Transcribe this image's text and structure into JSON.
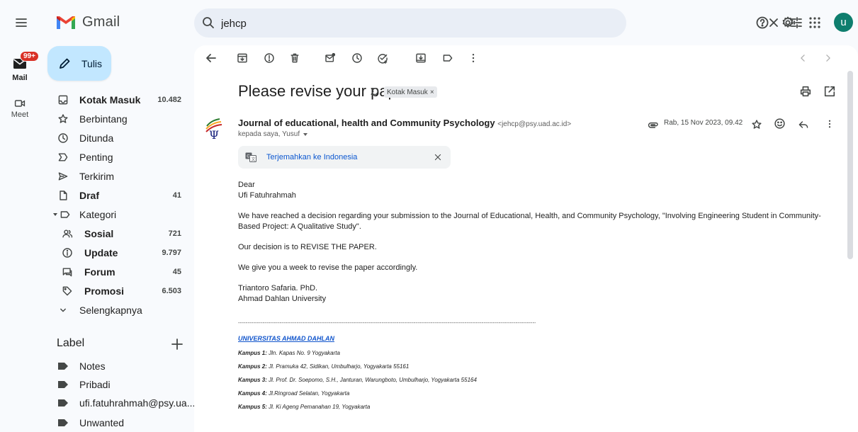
{
  "app": {
    "name": "Gmail"
  },
  "search": {
    "query": "jehcp"
  },
  "account": {
    "avatar_initial": "u"
  },
  "rail": {
    "mail_label": "Mail",
    "mail_badge": "99+",
    "meet_label": "Meet"
  },
  "compose": {
    "label": "Tulis"
  },
  "nav": [
    {
      "label": "Kotak Masuk",
      "count": "10.482",
      "icon": "inbox-icon",
      "bold": true
    },
    {
      "label": "Berbintang",
      "count": "",
      "icon": "star-icon"
    },
    {
      "label": "Ditunda",
      "count": "",
      "icon": "clock-icon"
    },
    {
      "label": "Penting",
      "count": "",
      "icon": "important-icon"
    },
    {
      "label": "Terkirim",
      "count": "",
      "icon": "send-icon"
    },
    {
      "label": "Draf",
      "count": "41",
      "icon": "draft-icon",
      "bold": true
    },
    {
      "label": "Kategori",
      "count": "",
      "icon": "label-icon"
    },
    {
      "label": "Sosial",
      "count": "721",
      "icon": "people-icon",
      "bold": true
    },
    {
      "label": "Update",
      "count": "9.797",
      "icon": "info-icon",
      "bold": true
    },
    {
      "label": "Forum",
      "count": "45",
      "icon": "forum-icon",
      "bold": true
    },
    {
      "label": "Promosi",
      "count": "6.503",
      "icon": "tag-icon",
      "bold": true
    },
    {
      "label": "Selengkapnya",
      "count": "",
      "icon": "chevron-down-icon"
    }
  ],
  "labels_section": {
    "title": "Label",
    "items": [
      "Notes",
      "Pribadi",
      "ufi.fatuhrahmah@psy.ua...",
      "Unwanted"
    ]
  },
  "email": {
    "subject": "Please revise your paper",
    "chip": "Kotak Masuk",
    "sender_name": "Journal of educational, health and Community Psychology",
    "sender_email": "<jehcp@psy.uad.ac.id>",
    "recipients": "kepada saya, Yusuf",
    "date": "Rab, 15 Nov 2023, 09.42",
    "translate": "Terjemahkan ke Indonesia",
    "greeting": "Dear",
    "recipient_name": "Ufi Fatuhrahmah",
    "para1": "We have reached a decision regarding your submission to the Journal of Educational, Health, and Community Psychology, \"Involving Engineering Student in Community-Based Project: A Qualitative Study\".",
    "para2": "Our decision is to REVISE THE PAPER.",
    "para3": "We give you a week to revise the paper accordingly.",
    "signature_name": "Triantoro Safaria. PhD.",
    "signature_org": "Ahmad Dahlan University",
    "divider": "------------------------------------------------------------------------------------------------------------------------------------------------------------------------------------------------------------",
    "university": "UNIVERSITAS AHMAD DAHLAN",
    "campuses": [
      {
        "label": "Kampus 1:",
        "address": "Jln. Kapas No. 9 Yogyakarta"
      },
      {
        "label": "Kampus 2:",
        "address": "Jl. Pramuka 42, Sidikan, Umbulharjo, Yogyakarta 55161"
      },
      {
        "label": "Kampus 3:",
        "address": "Jl. Prof. Dr. Soepomo, S.H., Janturan, Warungboto, Umbulharjo, Yogyakarta 55164"
      },
      {
        "label": "Kampus 4:",
        "address": "Jl.Ringroad Selatan, Yogyakarta"
      },
      {
        "label": "Kampus 5:",
        "address": "Jl. Ki Ageng Pemanahan 19, Yogyakarta"
      }
    ]
  },
  "colors": {
    "background": "#f8fafd",
    "compose": "#c2e7ff",
    "search": "#e9eef6",
    "badge": "#d93025",
    "avatar": "#0f7e6e",
    "link": "#0b57d0"
  }
}
